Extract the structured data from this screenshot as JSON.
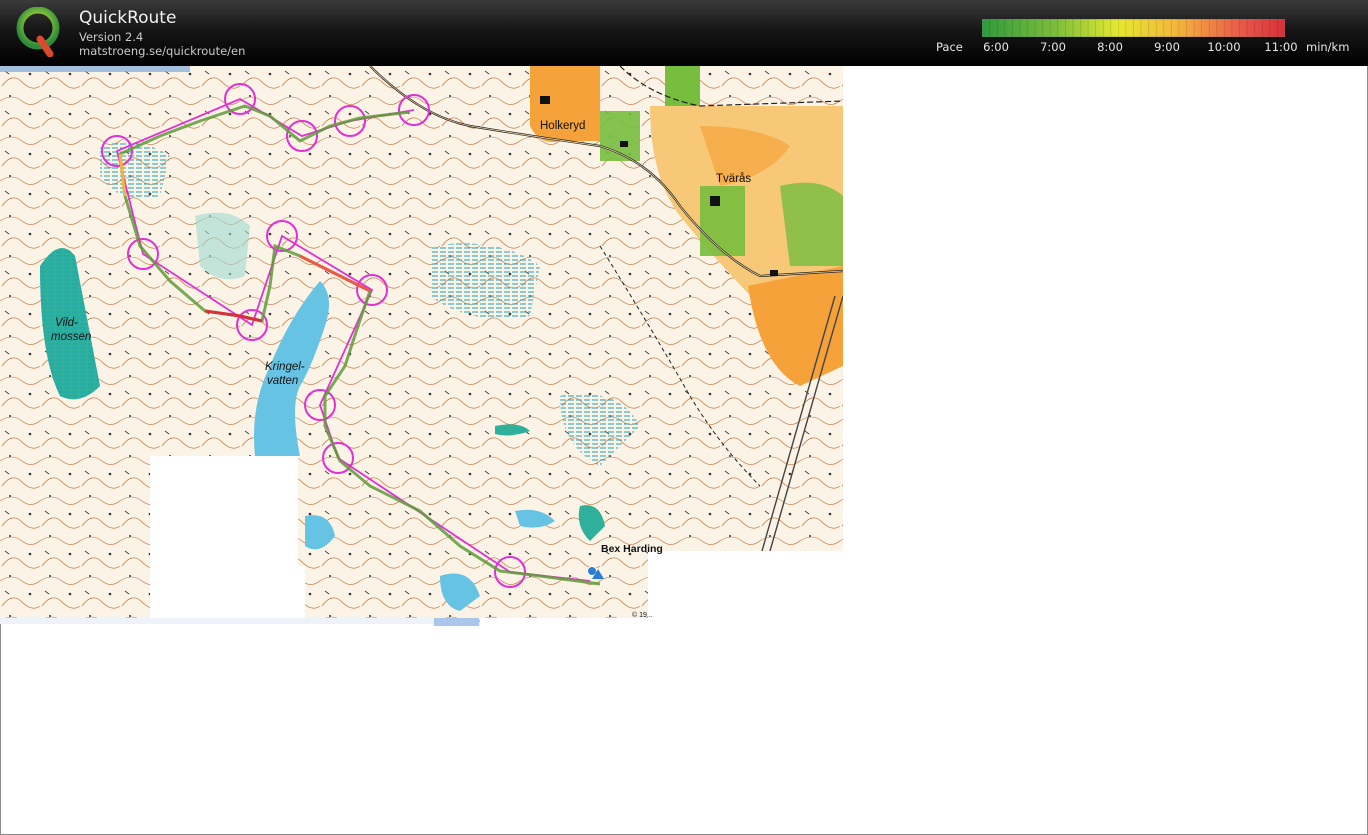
{
  "app": {
    "title": "QuickRoute",
    "version": "Version 2.4",
    "url": "matstroeng.se/quickroute/en"
  },
  "legend": {
    "label": "Pace",
    "unit": "min/km",
    "ticks": [
      "6:00",
      "7:00",
      "8:00",
      "9:00",
      "10:00",
      "11:00"
    ],
    "gradient_colors": [
      "#2f9a3c",
      "#7fbf3b",
      "#e5e830",
      "#f3b33c",
      "#ea5b4a",
      "#d6303a"
    ]
  },
  "map": {
    "labels": {
      "holkeryd": "Holkeryd",
      "tvaras": "Tvärås",
      "vildmossen_1": "Vild-",
      "vildmossen_2": "mossen",
      "kringelvatten_1": "Kringel-",
      "kringelvatten_2": "vatten",
      "credit": "Bex Harding",
      "copyright": "© 19..."
    },
    "colors": {
      "open_land": "#f7c877",
      "field": "#f6a23b",
      "water": "#67c3e3",
      "marsh": "#2eb09a",
      "forest_green": "#77be3e",
      "contour": "#b8622a",
      "course": "#e22fd6"
    }
  }
}
